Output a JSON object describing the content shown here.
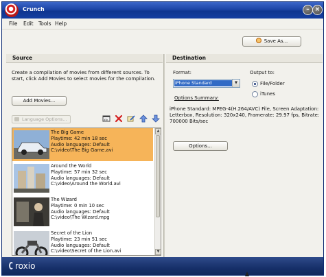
{
  "window": {
    "title": "Crunch",
    "icons": [
      "app-icon",
      "minimize-icon",
      "close-icon"
    ]
  },
  "menu": [
    "File",
    "Edit",
    "Tools",
    "Help"
  ],
  "toolbar": {
    "save_as_label": "Save As..."
  },
  "source": {
    "header": "Source",
    "description": "Create a compilation of movies from different sources. To start, click Add Movies to select movies for the compilation.",
    "add_movies_label": "Add Movies...",
    "language_options_label": "Language Options...",
    "toolbar_icons": [
      "subtitle-icon",
      "delete-icon",
      "edit-icon",
      "move-up-icon",
      "move-down-icon"
    ],
    "movies": [
      {
        "title": "The Big Game",
        "playtime": "Playtime: 42 min 18 sec",
        "audio": "Audio languages: Default",
        "path": "C:\\video\\The Big Game.avi",
        "selected": true
      },
      {
        "title": "Around the World",
        "playtime": "Playtime: 57 min 32 sec",
        "audio": "Audio languages: Default",
        "path": "C:\\video\\Around the World.avi",
        "selected": false
      },
      {
        "title": "The Wizard",
        "playtime": "Playtime: 0 min 10 sec",
        "audio": "Audio languages: Default",
        "path": "C:\\video\\The Wizard.mpg",
        "selected": false
      },
      {
        "title": "Secret of the Lion",
        "playtime": "Playtime: 23 min 51 sec",
        "audio": "Audio languages: Default",
        "path": "C:\\video\\Secret of the Lion.avi",
        "selected": false
      }
    ]
  },
  "destination": {
    "header": "Destination",
    "format_label": "Format:",
    "format_value": "iPhone Standard",
    "output_label": "Output to:",
    "output_options": [
      {
        "label": "File/Folder",
        "checked": true
      },
      {
        "label": "iTunes",
        "checked": false
      }
    ],
    "options_summary_label": "Options Summary:",
    "summary": "iPhone Standard: MPEG-4(H.264/AVC) File, Screen Adaptation: Letterbox, Resolution: 320x240, Framerate: 29.97 fps, Bitrate: 700000 Bits/sec",
    "options_button_label": "Options..."
  },
  "footer": {
    "brand": "roxio"
  },
  "colors": {
    "titlebar": "#1d45a6",
    "selected_row": "#f6b459",
    "footer": "#17306a",
    "select_highlight": "#316ac5"
  }
}
